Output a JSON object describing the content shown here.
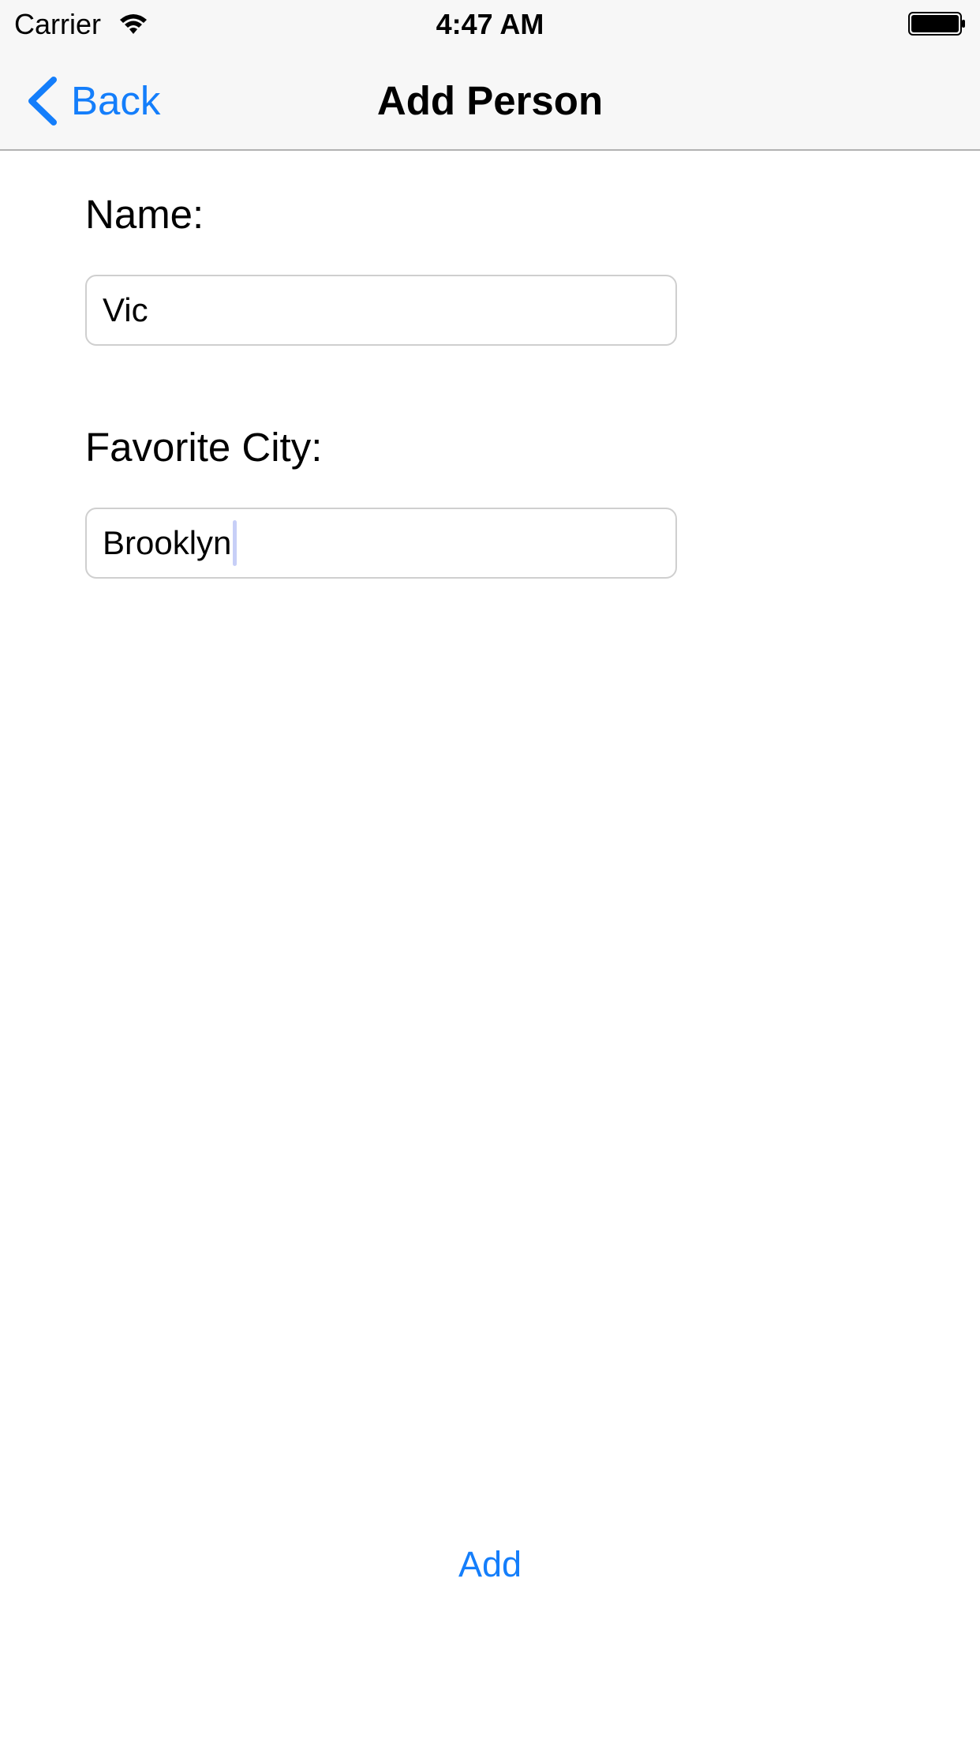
{
  "status_bar": {
    "carrier": "Carrier",
    "time": "4:47 AM",
    "wifi_icon": "wifi-icon",
    "battery_icon": "battery-icon"
  },
  "nav_bar": {
    "back_icon": "chevron-left-icon",
    "back_label": "Back",
    "title": "Add Person"
  },
  "form": {
    "name_label": "Name:",
    "name_value": "Vic",
    "city_label": "Favorite City:",
    "city_value": "Brooklyn"
  },
  "actions": {
    "add_label": "Add"
  },
  "colors": {
    "accent": "#147efb",
    "bar_background": "#f7f7f7",
    "bar_border": "#b2b2b2",
    "field_border": "#cfcfcf",
    "cursor": "#c7cff7"
  }
}
